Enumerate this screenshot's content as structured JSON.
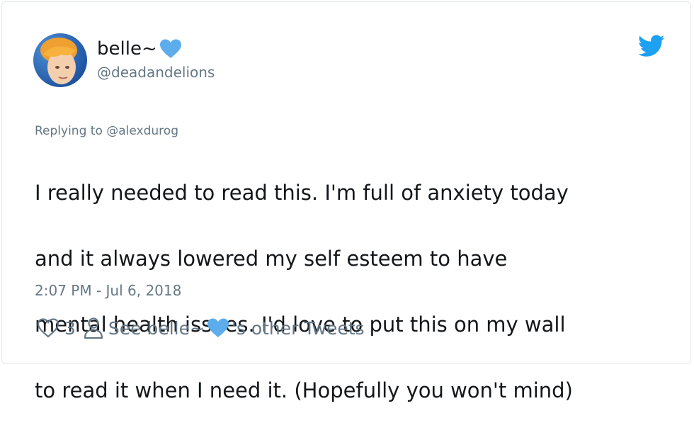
{
  "tweet": {
    "display_name": "belle~",
    "display_name_emoji": "blue-heart",
    "handle": "@deadandelions",
    "replying_prefix": "Replying to ",
    "replying_to": "@alexdurog",
    "text_lines": [
      "I really needed to read this. I'm full of anxiety today",
      "and it always lowered my self esteem to have",
      "mental health issues. I'd love to put this on my wall",
      "to read it when I need it. (Hopefully you won't mind)"
    ],
    "timestamp": "2:07 PM - Jul 6, 2018",
    "like_count": "3",
    "see_prefix": "See belle~",
    "see_suffix": "'s other Tweets"
  },
  "icons": {
    "brand": "twitter-bird-icon",
    "like": "heart-outline-icon",
    "profile": "person-outline-icon",
    "emoji": "blue-heart-emoji"
  },
  "colors": {
    "text_primary": "#14171a",
    "text_secondary": "#657786",
    "twitter_blue": "#1da1f2",
    "heart_blue": "#5dadec",
    "border": "#e1e8ed"
  }
}
